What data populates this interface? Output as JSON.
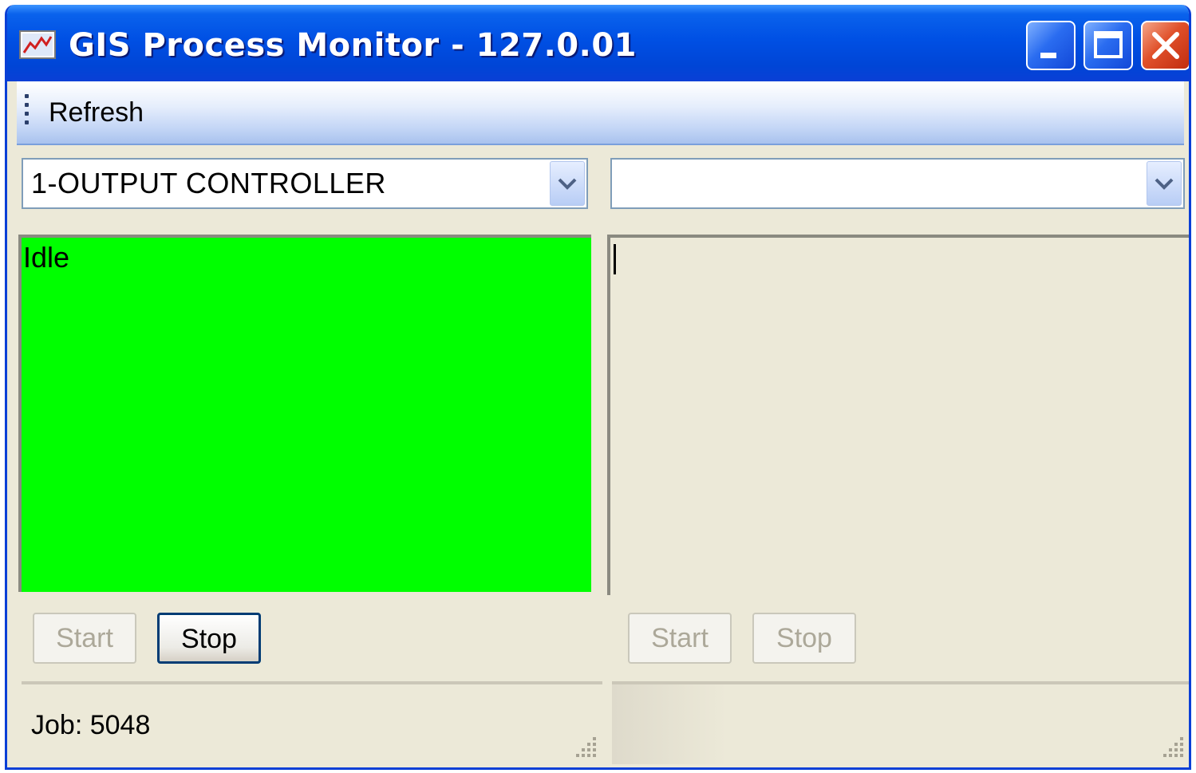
{
  "window": {
    "title": "GIS Process Monitor  -  127.0.01",
    "icon": "chart-icon",
    "controls": [
      "minimize-icon",
      "maximize-icon",
      "close-icon"
    ]
  },
  "menu": {
    "refresh_label": "Refresh"
  },
  "left": {
    "controller_selected": "1-OUTPUT CONTROLLER",
    "status": "Idle",
    "status_color": "#00ff00",
    "start_label": "Start",
    "stop_label": "Stop",
    "job_label": "Job: 5048"
  },
  "right": {
    "controller_selected": "",
    "status": "",
    "start_label": "Start",
    "stop_label": "Stop",
    "job_label": ""
  },
  "colors": {
    "titlebar": "#0050e4",
    "close": "#e0502a"
  }
}
